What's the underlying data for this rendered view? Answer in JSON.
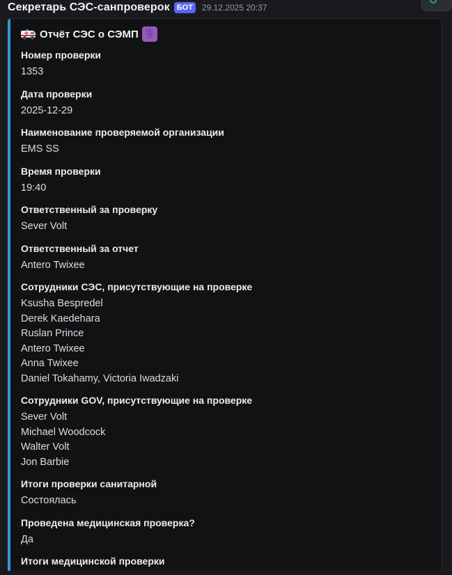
{
  "message": {
    "author": "Секретарь СЭС-санпроверок",
    "bot_tag": "БОТ",
    "timestamp": "29.12.2025 20:37"
  },
  "colors": {
    "embed_accent": "#3498db",
    "bot_tag": "#5865f2",
    "background": "#1a1a1e",
    "embed_background": "#111214"
  },
  "embed": {
    "title": "Отчёт СЭС о СЭМП",
    "title_icons": [
      "ambulance-icon",
      "medical-symbol-icon"
    ],
    "medical_glyph": "⚕️",
    "fields": [
      {
        "name": "Номер проверки",
        "values": [
          "1353"
        ]
      },
      {
        "name": "Дата проверки",
        "values": [
          "2025-12-29"
        ]
      },
      {
        "name": "Наименование проверяемой организации",
        "values": [
          "EMS SS"
        ]
      },
      {
        "name": "Время проверки",
        "values": [
          "19:40"
        ]
      },
      {
        "name": "Ответственный за проверку",
        "values": [
          "Sever Volt"
        ]
      },
      {
        "name": "Ответственный за отчет",
        "values": [
          "Antero Twixee"
        ]
      },
      {
        "name": "Сотрудники СЭС, присутствующие на проверке",
        "values": [
          "Ksusha Bespredel",
          "Derek Kaedehara",
          "Ruslan Prince",
          "Antero Twixee",
          "Anna Twixee",
          "Daniel Tokahamy, Victoria Iwadzaki"
        ]
      },
      {
        "name": "Сотрудники GOV, присутствующие на проверке",
        "values": [
          "Sever Volt",
          "Michael Woodcock",
          "Walter Volt",
          "Jon Barbie"
        ]
      },
      {
        "name": "Итоги проверки санитарной",
        "values": [
          "Состоялась"
        ]
      },
      {
        "name": "Проведена медицинская проверка?",
        "values": [
          "Да"
        ]
      },
      {
        "name": "Итоги медицинской проверки",
        "values": []
      }
    ]
  }
}
